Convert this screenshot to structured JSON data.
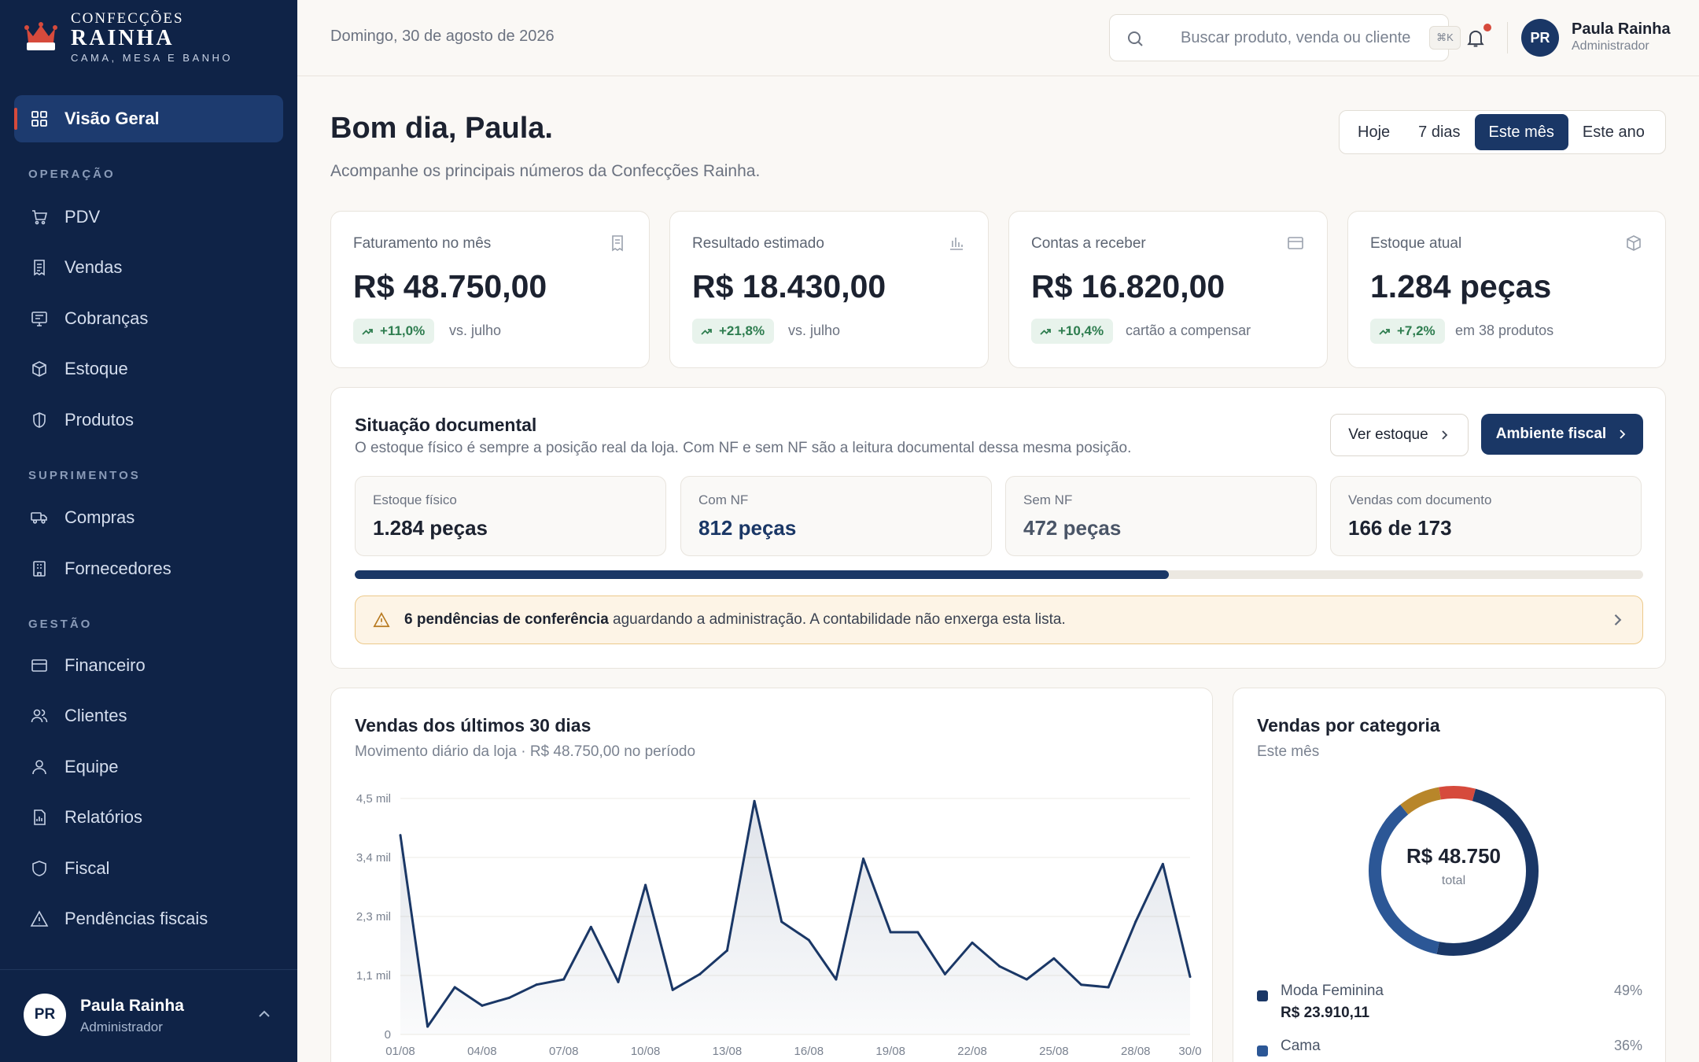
{
  "brand": {
    "line1": "CONFECÇÕES",
    "line2": "RAINHA",
    "line3": "CAMA, MESA E BANHO"
  },
  "colors": {
    "navy": "#0f2347",
    "accent": "#1a3766",
    "red": "#d64a3c",
    "gold": "#c9892b",
    "green": "#2e7d4f",
    "warning_bg": "#fdf4e6"
  },
  "sidebar": {
    "active": {
      "label": "Visão Geral",
      "icon": "grid-icon"
    },
    "sections": [
      {
        "title": "OPERAÇÃO",
        "items": [
          {
            "label": "PDV",
            "icon": "cart-icon"
          },
          {
            "label": "Vendas",
            "icon": "receipt-icon"
          },
          {
            "label": "Cobranças",
            "icon": "invoice-icon"
          },
          {
            "label": "Estoque",
            "icon": "box-icon"
          },
          {
            "label": "Produtos",
            "icon": "tag-icon"
          }
        ]
      },
      {
        "title": "SUPRIMENTOS",
        "items": [
          {
            "label": "Compras",
            "icon": "truck-icon"
          },
          {
            "label": "Fornecedores",
            "icon": "building-icon"
          }
        ]
      },
      {
        "title": "GESTÃO",
        "items": [
          {
            "label": "Financeiro",
            "icon": "wallet-icon"
          },
          {
            "label": "Clientes",
            "icon": "users-icon"
          },
          {
            "label": "Equipe",
            "icon": "user-icon"
          },
          {
            "label": "Relatórios",
            "icon": "report-icon"
          },
          {
            "label": "Fiscal",
            "icon": "shield-icon"
          },
          {
            "label": "Pendências fiscais",
            "icon": "warning-icon"
          }
        ]
      }
    ],
    "user": {
      "initials": "PR",
      "name": "Paula Rainha",
      "role": "Administrador"
    }
  },
  "header": {
    "date": "Domingo, 30 de agosto de 2026",
    "search_placeholder": "Buscar produto, venda ou cliente",
    "search_shortcut": "⌘K",
    "user": {
      "initials": "PR",
      "name": "Paula Rainha",
      "role": "Administrador"
    }
  },
  "page": {
    "greeting": "Bom dia, Paula.",
    "subtitle": "Acompanhe os principais números da Confecções Rainha.",
    "ranges": [
      "Hoje",
      "7 dias",
      "Este mês",
      "Este ano"
    ],
    "selected_range": "Este mês"
  },
  "kpis": [
    {
      "label": "Faturamento no mês",
      "icon": "receipt-icon",
      "value": "R$ 48.750,00",
      "delta": "+11,0%",
      "note": "vs. julho"
    },
    {
      "label": "Resultado estimado",
      "icon": "bar-chart-icon",
      "value": "R$ 18.430,00",
      "delta": "+21,8%",
      "note": "vs. julho"
    },
    {
      "label": "Contas a receber",
      "icon": "credit-card-icon",
      "value": "R$ 16.820,00",
      "delta": "+10,4%",
      "note": "cartão a compensar"
    },
    {
      "label": "Estoque atual",
      "icon": "box-icon",
      "value": "1.284 peças",
      "delta": "+7,2%",
      "note": "em 38 produtos"
    }
  ],
  "documental": {
    "title": "Situação documental",
    "subtitle": "O estoque físico é sempre a posição real da loja. Com NF e sem NF são a leitura documental dessa mesma posição.",
    "btn_stock": "Ver estoque",
    "btn_fiscal": "Ambiente fiscal",
    "stats": [
      {
        "label": "Estoque físico",
        "value": "1.284 peças"
      },
      {
        "label": "Com NF",
        "value": "812 peças"
      },
      {
        "label": "Sem NF",
        "value": "472 peças"
      },
      {
        "label": "Vendas com documento",
        "value": "166 de 173"
      }
    ],
    "nf_share": 0.632,
    "alert_bold": "6 pendências de conferência",
    "alert_text": " aguardando a administração. A contabilidade não enxerga esta lista."
  },
  "sales_card": {
    "title": "Vendas dos últimos 30 dias",
    "subtitle": "Movimento diário da loja · R$ 48.750,00 no período"
  },
  "chart_data": {
    "type": "area",
    "title": "Vendas dos últimos 30 dias",
    "x": [
      "01/08",
      "02/08",
      "03/08",
      "04/08",
      "05/08",
      "06/08",
      "07/08",
      "08/08",
      "09/08",
      "10/08",
      "11/08",
      "12/08",
      "13/08",
      "14/08",
      "15/08",
      "16/08",
      "17/08",
      "18/08",
      "19/08",
      "20/08",
      "21/08",
      "22/08",
      "23/08",
      "24/08",
      "25/08",
      "26/08",
      "27/08",
      "28/08",
      "29/08",
      "30/08"
    ],
    "x_tick_labels": [
      "01/08",
      "04/08",
      "07/08",
      "10/08",
      "13/08",
      "16/08",
      "19/08",
      "22/08",
      "25/08",
      "28/08",
      "30/0"
    ],
    "x_tick_index": [
      0,
      3,
      6,
      9,
      12,
      15,
      18,
      21,
      24,
      27,
      29
    ],
    "values": [
      3800,
      150,
      900,
      550,
      700,
      950,
      1050,
      2050,
      1000,
      2850,
      850,
      1150,
      1600,
      4450,
      2150,
      1800,
      1050,
      3350,
      1950,
      1950,
      1150,
      1750,
      1300,
      1050,
      1450,
      950,
      900,
      2150,
      3250,
      1100
    ],
    "y_ticks": [
      "0",
      "1,1 mil",
      "2,3 mil",
      "3,4 mil",
      "4,5 mil"
    ],
    "y_tick_values": [
      0,
      1125,
      2250,
      3375,
      4500
    ],
    "ylim": [
      0,
      4500
    ],
    "grid": true
  },
  "category_card": {
    "title": "Vendas por categoria",
    "subtitle": "Este mês",
    "total": "R$ 48.750",
    "total_label": "total",
    "donut_shares": [
      0.49,
      0.36,
      0.08,
      0.07
    ],
    "donut_colors": [
      "#1a3766",
      "#2c5796",
      "#b8862a",
      "#d64a3c"
    ],
    "items": [
      {
        "name": "Moda Feminina",
        "value": "R$ 23.910,11",
        "pct": "49%",
        "color": "#1a3766"
      },
      {
        "name": "Cama",
        "pct": "36%",
        "color": "#2c5796"
      }
    ]
  }
}
